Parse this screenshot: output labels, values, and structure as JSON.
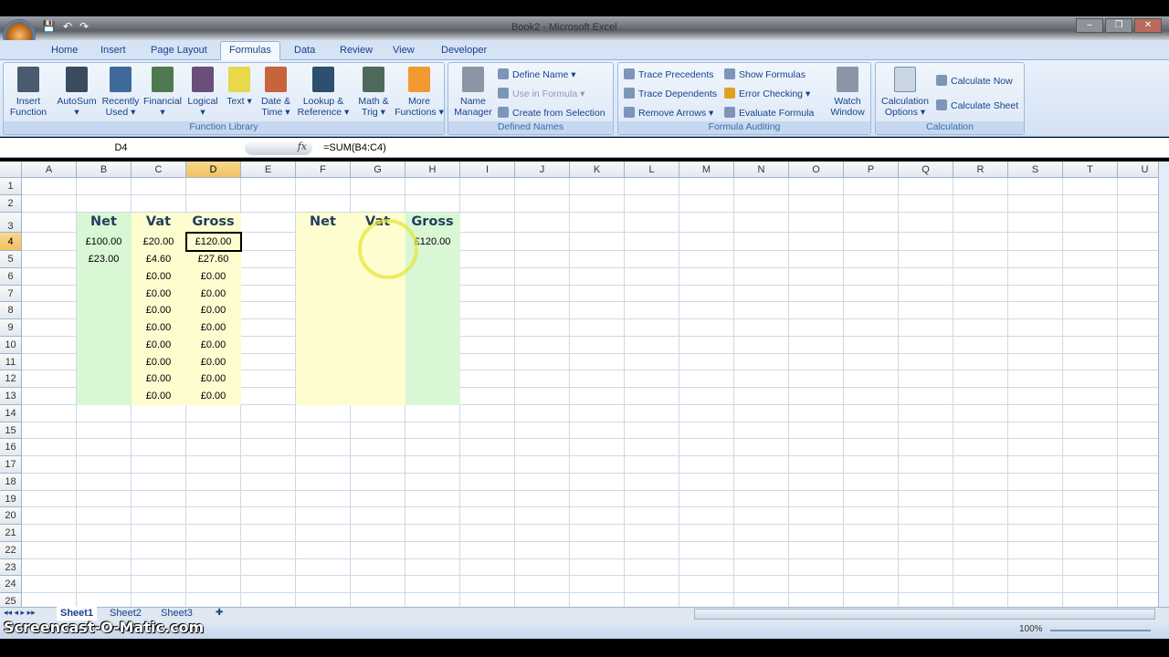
{
  "window": {
    "title": "Book2 - Microsoft Excel",
    "minimize": "–",
    "restore": "❐",
    "close": "✕"
  },
  "ribbon_tabs": [
    "Home",
    "Insert",
    "Page Layout",
    "Formulas",
    "Data",
    "Review",
    "View",
    "Developer"
  ],
  "active_tab": "Formulas",
  "function_library": {
    "label": "Function Library",
    "buttons": [
      {
        "label": "Insert Function",
        "icon": "fx-icon",
        "color": "#4a5a70"
      },
      {
        "label": "AutoSum ▾",
        "icon": "sigma-icon",
        "color": "#3c4a5e"
      },
      {
        "label": "Recently Used ▾",
        "icon": "book-blue-icon",
        "color": "#3e6a9a"
      },
      {
        "label": "Financial ▾",
        "icon": "book-green-icon",
        "color": "#4f7a4f"
      },
      {
        "label": "Logical ▾",
        "icon": "book-purple-icon",
        "color": "#6a4f7a"
      },
      {
        "label": "Text ▾",
        "icon": "book-yellow-icon",
        "color": "#e8d84a"
      },
      {
        "label": "Date & Time ▾",
        "icon": "book-red-icon",
        "color": "#c8643c"
      },
      {
        "label": "Lookup & Reference ▾",
        "icon": "book-navy-icon",
        "color": "#2e4f6e"
      },
      {
        "label": "Math & Trig ▾",
        "icon": "book-teal-icon",
        "color": "#4d6a5a"
      },
      {
        "label": "More Functions ▾",
        "icon": "books-orange-icon",
        "color": "#f09a30"
      }
    ]
  },
  "defined_names": {
    "label": "Defined Names",
    "name_manager": "Name Manager",
    "define_name": "Define Name ▾",
    "use_in_formula": "Use in Formula ▾",
    "create_from_selection": "Create from Selection"
  },
  "formula_auditing": {
    "label": "Formula Auditing",
    "trace_precedents": "Trace Precedents",
    "trace_dependents": "Trace Dependents",
    "remove_arrows": "Remove Arrows ▾",
    "show_formulas": "Show Formulas",
    "error_checking": "Error Checking ▾",
    "evaluate_formula": "Evaluate Formula",
    "watch_window": "Watch Window"
  },
  "calculation": {
    "label": "Calculation",
    "options": "Calculation Options ▾",
    "calculate_now": "Calculate Now",
    "calculate_sheet": "Calculate Sheet"
  },
  "formula_bar": {
    "name_box": "D4",
    "fx": "fx",
    "formula": "=SUM(B4:C4)"
  },
  "grid": {
    "columns": [
      "A",
      "B",
      "C",
      "D",
      "E",
      "F",
      "G",
      "H",
      "I",
      "J",
      "K",
      "L",
      "M",
      "N",
      "O",
      "P",
      "Q",
      "R",
      "S",
      "T",
      "U"
    ],
    "row_count": 25,
    "selected_cell": "D4",
    "fills": [
      {
        "range": "B3:B13",
        "color": "#d9f7d4"
      },
      {
        "range": "C3:D13",
        "color": "#fdfdd0"
      },
      {
        "range": "F3:G13",
        "color": "#fdfdd0"
      },
      {
        "range": "H3:H13",
        "color": "#d9f7d4"
      }
    ],
    "cells": [
      {
        "ref": "B3",
        "value": "Net",
        "header": true
      },
      {
        "ref": "C3",
        "value": "Vat",
        "header": true
      },
      {
        "ref": "D3",
        "value": "Gross",
        "header": true
      },
      {
        "ref": "F3",
        "value": "Net",
        "header": true
      },
      {
        "ref": "G3",
        "value": "Vat",
        "header": true
      },
      {
        "ref": "H3",
        "value": "Gross",
        "header": true
      },
      {
        "ref": "B4",
        "value": "£100.00"
      },
      {
        "ref": "C4",
        "value": "£20.00"
      },
      {
        "ref": "D4",
        "value": "£120.00"
      },
      {
        "ref": "H4",
        "value": "£120.00"
      },
      {
        "ref": "B5",
        "value": "£23.00"
      },
      {
        "ref": "C5",
        "value": "£4.60"
      },
      {
        "ref": "D5",
        "value": "£27.60"
      },
      {
        "ref": "C6",
        "value": "£0.00"
      },
      {
        "ref": "D6",
        "value": "£0.00"
      },
      {
        "ref": "C7",
        "value": "£0.00"
      },
      {
        "ref": "D7",
        "value": "£0.00"
      },
      {
        "ref": "C8",
        "value": "£0.00"
      },
      {
        "ref": "D8",
        "value": "£0.00"
      },
      {
        "ref": "C9",
        "value": "£0.00"
      },
      {
        "ref": "D9",
        "value": "£0.00"
      },
      {
        "ref": "C10",
        "value": "£0.00"
      },
      {
        "ref": "D10",
        "value": "£0.00"
      },
      {
        "ref": "C11",
        "value": "£0.00"
      },
      {
        "ref": "D11",
        "value": "£0.00"
      },
      {
        "ref": "C12",
        "value": "£0.00"
      },
      {
        "ref": "D12",
        "value": "£0.00"
      },
      {
        "ref": "C13",
        "value": "£0.00"
      },
      {
        "ref": "D13",
        "value": "£0.00"
      }
    ]
  },
  "sheet_tabs": [
    "Sheet1",
    "Sheet2",
    "Sheet3"
  ],
  "active_sheet": "Sheet1",
  "status": {
    "zoom": "100%"
  },
  "watermark": "Screencast-O-Matic.com"
}
